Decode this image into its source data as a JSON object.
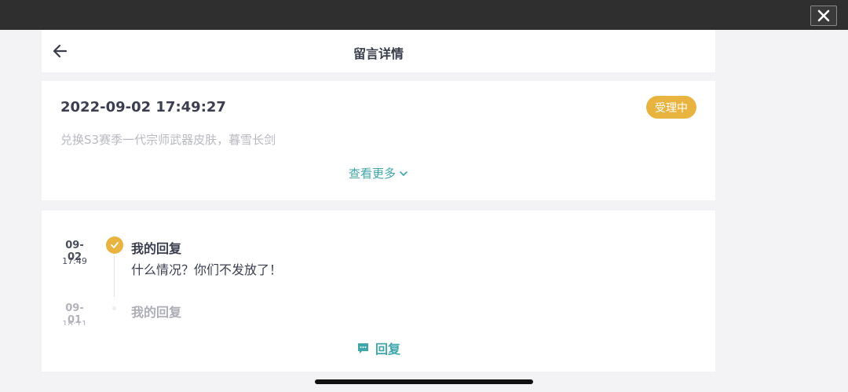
{
  "header": {
    "title": "留言详情"
  },
  "message": {
    "datetime": "2022-09-02 17:49:27",
    "status": "受理中",
    "content": "兑换S3赛季一代宗师武器皮肤，暮雪长剑",
    "more_label": "查看更多"
  },
  "timeline": [
    {
      "date": "09-02",
      "time": "17:49",
      "title": "我的回复",
      "text": "什么情况？你们不发放了！"
    },
    {
      "date": "09-01",
      "time": "18:11",
      "title": "我的回复",
      "text": ""
    }
  ],
  "actions": {
    "reply_label": "回复"
  },
  "colors": {
    "accent": "#3fa6ab",
    "status": "#e9b33f",
    "topbar": "#2f2f2f"
  },
  "icons": {
    "close": "close-icon",
    "back": "arrow-left-icon",
    "more": "chevron-down-icon",
    "reply": "chat-bubble-icon",
    "done": "check-icon"
  }
}
